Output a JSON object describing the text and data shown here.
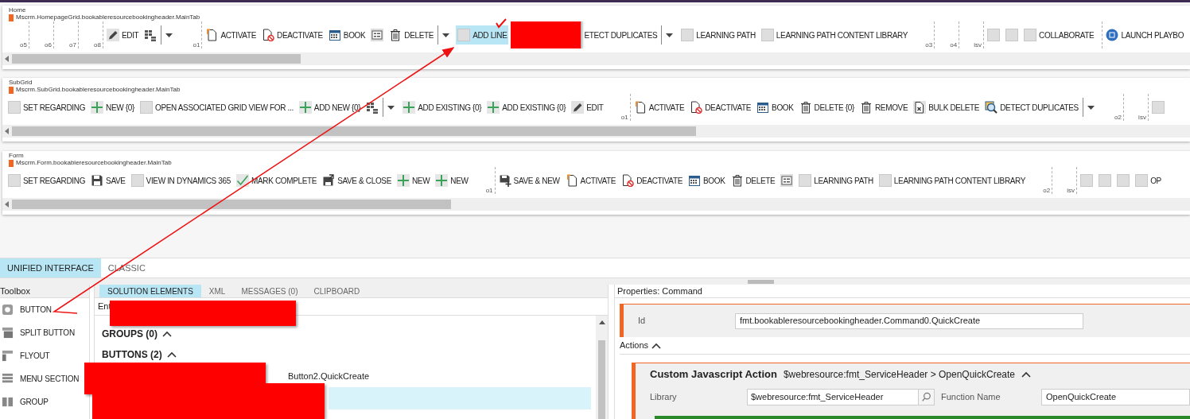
{
  "panels": [
    {
      "title": "Home",
      "id": "Mscrm.HomepageGrid.bookableresourcebookingheader.MainTab",
      "items": [
        {
          "kind": "marker",
          "label": "o5"
        },
        {
          "kind": "marker",
          "label": "o6"
        },
        {
          "kind": "marker",
          "label": "o7"
        },
        {
          "kind": "marker",
          "label": "o8"
        },
        {
          "kind": "pencil",
          "label": "EDIT",
          "selected": false
        },
        {
          "kind": "grid",
          "selected": false
        },
        {
          "kind": "dropdown"
        },
        {
          "kind": "marker",
          "label": "o1"
        },
        {
          "kind": "activate",
          "label": "ACTIVATE",
          "selected": false
        },
        {
          "kind": "deactivate",
          "label": "DEACTIVATE",
          "selected": false
        },
        {
          "kind": "calendar",
          "label": "BOOK",
          "selected": false
        },
        {
          "kind": "form",
          "selected": false
        },
        {
          "kind": "trash",
          "label": "DELETE",
          "selected": false
        },
        {
          "kind": "dropdown"
        },
        {
          "kind": "blank",
          "label": "ADD LINE",
          "selected": true
        },
        {
          "kind": "redacted"
        },
        {
          "kind": "text",
          "label": "ETECT DUPLICATES",
          "selected": false
        },
        {
          "kind": "dropdown"
        },
        {
          "kind": "blank",
          "label": "LEARNING PATH",
          "selected": false
        },
        {
          "kind": "blank",
          "label": "LEARNING PATH CONTENT LIBRARY",
          "selected": false
        },
        {
          "kind": "marker",
          "label": "o3"
        },
        {
          "kind": "marker",
          "label": "o4"
        },
        {
          "kind": "marker",
          "label": "isv"
        },
        {
          "kind": "blank",
          "selected": false
        },
        {
          "kind": "blank",
          "selected": false
        },
        {
          "kind": "blank",
          "label": "COLLABORATE",
          "selected": false
        },
        {
          "kind": "marker"
        },
        {
          "kind": "launch",
          "label": "LAUNCH PLAYBO",
          "selected": false
        }
      ]
    },
    {
      "title": "SubGrid",
      "id": "Mscrm.SubGrid.bookableresourcebookingheader.MainTab",
      "items": [
        {
          "kind": "blank",
          "label": "SET REGARDING",
          "selected": false
        },
        {
          "kind": "plus",
          "label": "NEW {0}",
          "selected": false
        },
        {
          "kind": "blank",
          "label": "OPEN ASSOCIATED GRID VIEW FOR ...",
          "selected": false
        },
        {
          "kind": "plus",
          "label": "ADD NEW {0}",
          "selected": false
        },
        {
          "kind": "grid",
          "selected": false
        },
        {
          "kind": "dropdown"
        },
        {
          "kind": "plus",
          "label": "ADD EXISTING {0}",
          "selected": false
        },
        {
          "kind": "plus",
          "label": "ADD EXISTING {0}",
          "selected": false
        },
        {
          "kind": "pencil",
          "label": "EDIT",
          "selected": false
        },
        {
          "kind": "marker",
          "label": "o1"
        },
        {
          "kind": "activate",
          "label": "ACTIVATE",
          "selected": false
        },
        {
          "kind": "deactivate",
          "label": "DEACTIVATE",
          "selected": false
        },
        {
          "kind": "calendar",
          "label": "BOOK",
          "selected": false
        },
        {
          "kind": "trash",
          "label": "DELETE {0}",
          "selected": false
        },
        {
          "kind": "trash",
          "label": "REMOVE",
          "selected": false
        },
        {
          "kind": "bulkdelete",
          "label": "BULK DELETE",
          "selected": false
        },
        {
          "kind": "detect",
          "label": "DETECT DUPLICATES",
          "selected": false
        },
        {
          "kind": "dropdown"
        },
        {
          "kind": "marker",
          "label": "o2"
        },
        {
          "kind": "marker",
          "label": "isv"
        },
        {
          "kind": "blank",
          "selected": false
        }
      ]
    },
    {
      "title": "Form",
      "id": "Mscrm.Form.bookableresourcebookingheader.MainTab",
      "items": [
        {
          "kind": "blank",
          "label": "SET REGARDING",
          "selected": false
        },
        {
          "kind": "save",
          "label": "SAVE",
          "selected": false
        },
        {
          "kind": "blank",
          "label": "VIEW IN DYNAMICS 365",
          "selected": false
        },
        {
          "kind": "check",
          "label": "MARK COMPLETE",
          "selected": false
        },
        {
          "kind": "saveclose",
          "label": "SAVE & CLOSE",
          "selected": false
        },
        {
          "kind": "plus",
          "label": "NEW",
          "selected": false
        },
        {
          "kind": "plus",
          "label": "NEW",
          "selected": false
        },
        {
          "kind": "marker",
          "label": "o1"
        },
        {
          "kind": "savenew",
          "label": "SAVE & NEW",
          "selected": false
        },
        {
          "kind": "activate",
          "label": "ACTIVATE",
          "selected": false
        },
        {
          "kind": "deactivate",
          "label": "DEACTIVATE",
          "selected": false
        },
        {
          "kind": "calendar",
          "label": "BOOK",
          "selected": false
        },
        {
          "kind": "trash",
          "label": "DELETE",
          "selected": false
        },
        {
          "kind": "form",
          "selected": false
        },
        {
          "kind": "blank",
          "label": "LEARNING PATH",
          "selected": false
        },
        {
          "kind": "blank",
          "label": "LEARNING PATH CONTENT LIBRARY",
          "selected": false
        },
        {
          "kind": "marker",
          "label": "o2"
        },
        {
          "kind": "marker",
          "label": "isv"
        },
        {
          "kind": "blank",
          "selected": false
        },
        {
          "kind": "blank",
          "selected": false
        },
        {
          "kind": "blank",
          "selected": false
        },
        {
          "kind": "blank",
          "label": "OP",
          "selected": false
        }
      ]
    }
  ],
  "designer_tabs": [
    {
      "label": "UNIFIED INTERFACE",
      "selected": true
    },
    {
      "label": "CLASSIC",
      "selected": false
    }
  ],
  "toolbox": {
    "title": "Toolbox",
    "items": [
      {
        "kind": "button",
        "label": "BUTTON"
      },
      {
        "kind": "split",
        "label": "SPLIT BUTTON"
      },
      {
        "kind": "flyout",
        "label": "FLYOUT"
      },
      {
        "kind": "menu",
        "label": "MENU SECTION"
      },
      {
        "kind": "group",
        "label": "GROUP"
      }
    ]
  },
  "solution_panel": {
    "tabs": [
      {
        "label": "SOLUTION ELEMENTS",
        "selected": true
      },
      {
        "label": "XML",
        "selected": false
      },
      {
        "label": "MESSAGES (0)",
        "selected": false
      },
      {
        "label": "CLIPBOARD",
        "selected": false
      }
    ],
    "filter_label": "Ent",
    "sections": [
      {
        "title": "GROUPS (0)",
        "expanded": true
      },
      {
        "title": "BUTTONS (2)",
        "expanded": true
      }
    ],
    "rows": [
      {
        "label": "Button2.QuickCreate",
        "selected": false
      },
      {
        "selected": true
      }
    ]
  },
  "properties": {
    "title": "Properties: Command",
    "id_label": "Id",
    "id_value": "fmt.bookableresourcebookingheader.Command0.QuickCreate",
    "actions_label": "Actions",
    "actions_expanded": true,
    "action": {
      "title": "Custom Javascript Action",
      "summary": "$webresource:fmt_ServiceHeader > OpenQuickCreate",
      "expanded": true,
      "library_label": "Library",
      "library_value": "$webresource:fmt_ServiceHeader",
      "function_label": "Function Name",
      "function_value": "OpenQuickCreate"
    }
  }
}
